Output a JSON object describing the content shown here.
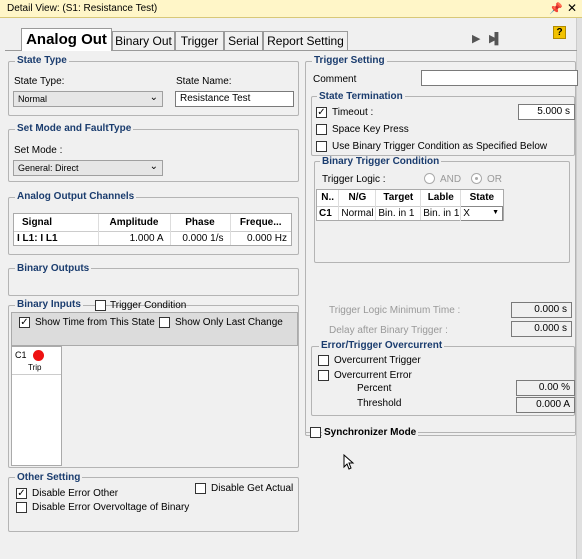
{
  "window": {
    "title": "Detail View: (S1: Resistance Test)",
    "pin": "▕",
    "close": "✕"
  },
  "tabs": [
    "Analog Out",
    "Binary Out",
    "Trigger",
    "Serial",
    "Report Setting"
  ],
  "toolbar": {
    "play": "▶",
    "step": "▶▌",
    "help": "?"
  },
  "state_type": {
    "title": "State Type",
    "type_label": "State Type:",
    "type_value": "Normal",
    "name_label": "State Name:",
    "name_value": "Resistance Test"
  },
  "mode": {
    "title": "Set Mode and FaultType",
    "mode_label": "Set Mode :",
    "mode_value": "General: Direct"
  },
  "analog": {
    "title": "Analog Output Channels",
    "headers": [
      "Signal",
      "Amplitude",
      "Phase",
      "Freque..."
    ],
    "row": [
      "I L1: I L1",
      "1.000 A",
      "0.000 1/s",
      "0.000 Hz"
    ]
  },
  "binary_outputs": {
    "title": "Binary Outputs"
  },
  "binary_inputs": {
    "title": "Binary Inputs",
    "trigger_condition": "Trigger Condition",
    "show_time": "Show Time from This State",
    "show_last": "Show Only Last Change",
    "channel": "C1",
    "channel_name": "Trip",
    "led_color": "#ee1111"
  },
  "other": {
    "title": "Other Setting",
    "disable_error_other": "Disable Error Other",
    "disable_get_actual": "Disable Get Actual",
    "disable_overvoltage": "Disable Error Overvoltage of Binary"
  },
  "trigger": {
    "title": "Trigger Setting",
    "comment_label": "Comment",
    "termination": {
      "title": "State Termination",
      "timeout_label": "Timeout :",
      "timeout_value": "5.000 s",
      "space_key": "Space Key Press",
      "use_binary": "Use Binary Trigger Condition as Specified Below"
    },
    "binary_condition": {
      "title": "Binary Trigger Condition",
      "logic_label": "Trigger Logic :",
      "and": "AND",
      "or": "OR",
      "headers": [
        "N..",
        "N/G",
        "Target",
        "Lable",
        "State"
      ],
      "row": [
        "C1",
        "Normal",
        "Bin. in 1",
        "Bin. in 1",
        "X"
      ]
    },
    "min_time_label": "Trigger Logic Minimum Time :",
    "min_time_value": "0.000 s",
    "delay_label": "Delay after Binary Trigger :",
    "delay_value": "0.000 s",
    "overcurrent": {
      "title": "Error/Trigger Overcurrent",
      "trigger": "Overcurrent Trigger",
      "error": "Overcurrent Error",
      "percent_label": "Percent",
      "percent_value": "0.00 %",
      "threshold_label": "Threshold",
      "threshold_value": "0.000 A"
    },
    "sync": "Synchronizer Mode"
  }
}
